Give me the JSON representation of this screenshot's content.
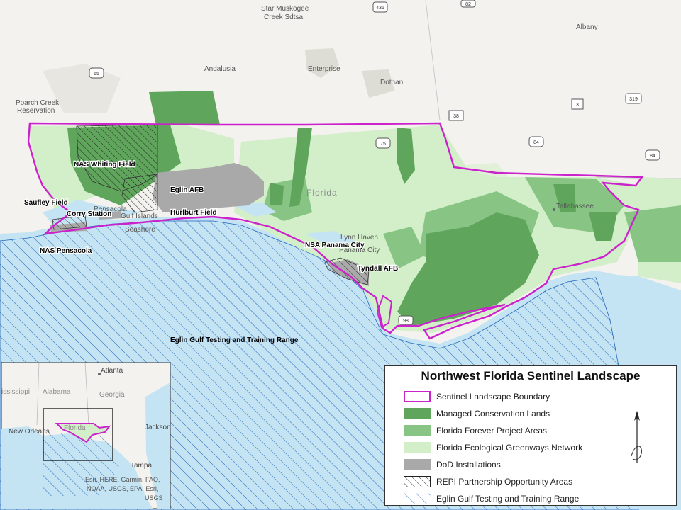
{
  "legend": {
    "title": "Northwest Florida Sentinel Landscape",
    "items": [
      {
        "label": "Sentinel Landscape Boundary",
        "icon": "boundary-swatch"
      },
      {
        "label": "Managed Conservation Lands",
        "color": "#5fa65c"
      },
      {
        "label": "Florida Forever Project Areas",
        "color": "#88c585"
      },
      {
        "label": "Florida Ecological Greenways Network",
        "color": "#d3efc9"
      },
      {
        "label": "DoD Installations",
        "color": "#a9a9a9"
      },
      {
        "label": "REPI Partnership Opportunity Areas",
        "icon": "black-hatch"
      },
      {
        "label": "Eglin Gulf Testing and Training Range",
        "icon": "blue-hatch"
      }
    ]
  },
  "colors": {
    "boundary": "#cc22cc",
    "water": "#c4e3f3",
    "land": "#f3f2ee",
    "managed": "#5fa65c",
    "forever": "#88c585",
    "greenway": "#d3efc9",
    "dod": "#a9a9a9",
    "range_hatch": "#2266bb"
  },
  "installations": {
    "nas_whiting": "NAS Whiting Field",
    "eglin": "Eglin AFB",
    "saufley": "Saufley Field",
    "corry": "Corry Station",
    "hurlburt": "Hurlburt Field",
    "nas_pensacola": "NAS Pensacola",
    "nsa_panama": "NSA Panama City",
    "tyndall": "Tyndall AFB",
    "range": "Eglin Gulf Testing and Training Range"
  },
  "places": {
    "star_muskogee": "Star Muskogee",
    "creek_sdtsa": "Creek Sdtsa",
    "albany": "Albany",
    "andalusia": "Andalusia",
    "enterprise": "Enterprise",
    "dothan": "Dothan",
    "poarch_1": "Poarch Creek",
    "poarch_2": "Reservation",
    "florida": "Florida",
    "tallahassee": "Tallahassee",
    "pensacola": "Pensacola",
    "lynn_haven": "Lynn Haven",
    "panama_city": "Panama City",
    "gulf_islands": "Gulf Islands",
    "seashore": "Seashore"
  },
  "shields": [
    "431",
    "82",
    "65",
    "38",
    "3",
    "319",
    "75",
    "84",
    "84",
    "98"
  ],
  "inset": {
    "atlanta": "Atlanta",
    "alabama": "Alabama",
    "georgia": "Georgia",
    "mississippi": "ississippi",
    "new_orleans": "New Orleans",
    "florida": "Florida",
    "jacksonville": "Jackson",
    "tampa": "Tampa",
    "credit_1": "Esri, HERE, Garmin, FAO,",
    "credit_2": "NOAA, USGS, EPA, Esri,",
    "credit_3": "USGS"
  }
}
